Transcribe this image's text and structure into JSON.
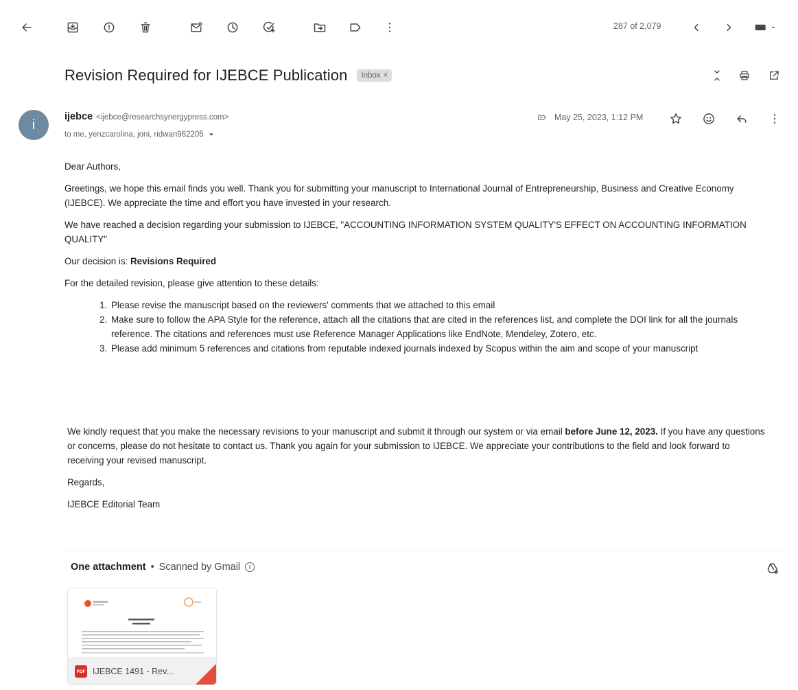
{
  "toolbar": {
    "counter": "287 of 2,079"
  },
  "subject": {
    "title": "Revision Required for IJEBCE Publication",
    "label": "Inbox",
    "label_close": "×"
  },
  "sender": {
    "avatar_letter": "i",
    "name": "ijebce",
    "email": "<ijebce@researchsynergypress.com>",
    "recipients": "to me, yenzcarolina, joni, ridwan962205"
  },
  "meta": {
    "date": "May 25, 2023, 1:12 PM"
  },
  "message": {
    "greeting": "Dear Authors,",
    "para1": "Greetings, we hope this email finds you well. Thank you for submitting your manuscript to International Journal of Entrepreneurship, Business and Creative Economy (IJEBCE). We appreciate the time and effort you have invested in your research.",
    "para2": "We have reached a decision regarding your submission to IJEBCE, \"ACCOUNTING INFORMATION SYSTEM QUALITY'S EFFECT ON ACCOUNTING INFORMATION QUALITY\"",
    "decision_prefix": "Our decision is: ",
    "decision_value": "Revisions Required",
    "details_intro": "For the detailed revision, please give attention to these details:",
    "items": [
      "Please revise the manuscript based on the reviewers' comments that we attached to this email",
      "Make sure to follow the APA Style for the reference, attach all the citations that are cited in the references list, and complete the DOI link for all the journals reference. The citations and references must use Reference Manager Applications like EndNote, Mendeley, Zotero, etc.",
      " Please add minimum 5 references and citations from reputable indexed journals indexed by Scopus within the aim and scope of your manuscript"
    ],
    "request_part1": "We kindly request that you make the necessary revisions to your manuscript and submit it through our system or via email ",
    "request_deadline": "before June 12, 2023.",
    "request_part2": " If you have any questions or concerns, please do not hesitate to contact us. Thank you again for your submission to IJEBCE. We appreciate your contributions to the field and look forward to receiving your revised manuscript.",
    "regards": "Regards,",
    "signature": "IJEBCE Editorial Team"
  },
  "attachments": {
    "title": "One attachment",
    "separator": "•",
    "scanned": "Scanned by Gmail",
    "info_glyph": "i",
    "file_name": "IJEBCE 1491 - Rev...",
    "file_type": "PDF"
  },
  "colors": {
    "avatar": "#6d8aa0",
    "pdf_red": "#d93025",
    "icon": "#444746",
    "muted_text": "#5f6368"
  }
}
